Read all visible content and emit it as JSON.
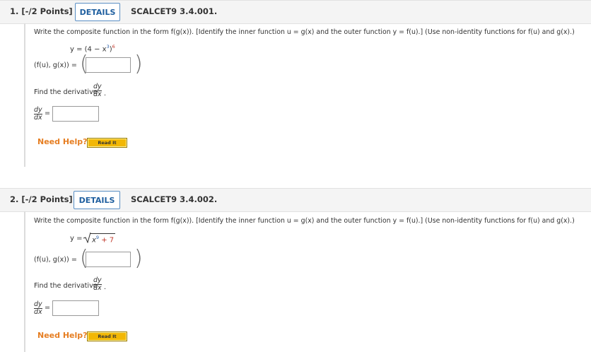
{
  "questions": [
    {
      "number": "1. [-/2 Points]",
      "details_label": "DETAILS",
      "code": "SCALCET9 3.4.001.",
      "instruction": "Write the composite function in the form f(g(x)). [Identify the inner function u = g(x) and the outer function y = f(u).] (Use non-identity functions for f(u) and g(x).)",
      "function_y": "y = (4 − x",
      "function_inner_exp": "3",
      "function_close": ")",
      "function_outer_exp": "6",
      "composite_label": "(f(u), g(x)) =",
      "derivative_prompt": "Find the derivative",
      "dy": "dy",
      "dx": "dx",
      "need_help": "Need Help?",
      "read_it": "Read It"
    },
    {
      "number": "2. [-/2 Points]",
      "details_label": "DETAILS",
      "code": "SCALCET9 3.4.002.",
      "instruction": "Write the composite function in the form f(g(x)). [Identify the inner function u = g(x) and the outer function y = f(u).] (Use non-identity functions for f(u) and g(x).)",
      "function_y": "y =",
      "radicand": "x",
      "radicand_exp": "9",
      "radicand_tail": "+ 7",
      "composite_label": "(f(u), g(x)) =",
      "derivative_prompt": "Find the derivative",
      "dy": "dy",
      "dx": "dx",
      "need_help": "Need Help?",
      "read_it": "Read It"
    }
  ],
  "colors": {
    "accent": "#1f5f9f",
    "help": "#e67e22",
    "read_it": "#f2b705",
    "exponent": "#c0392b"
  }
}
